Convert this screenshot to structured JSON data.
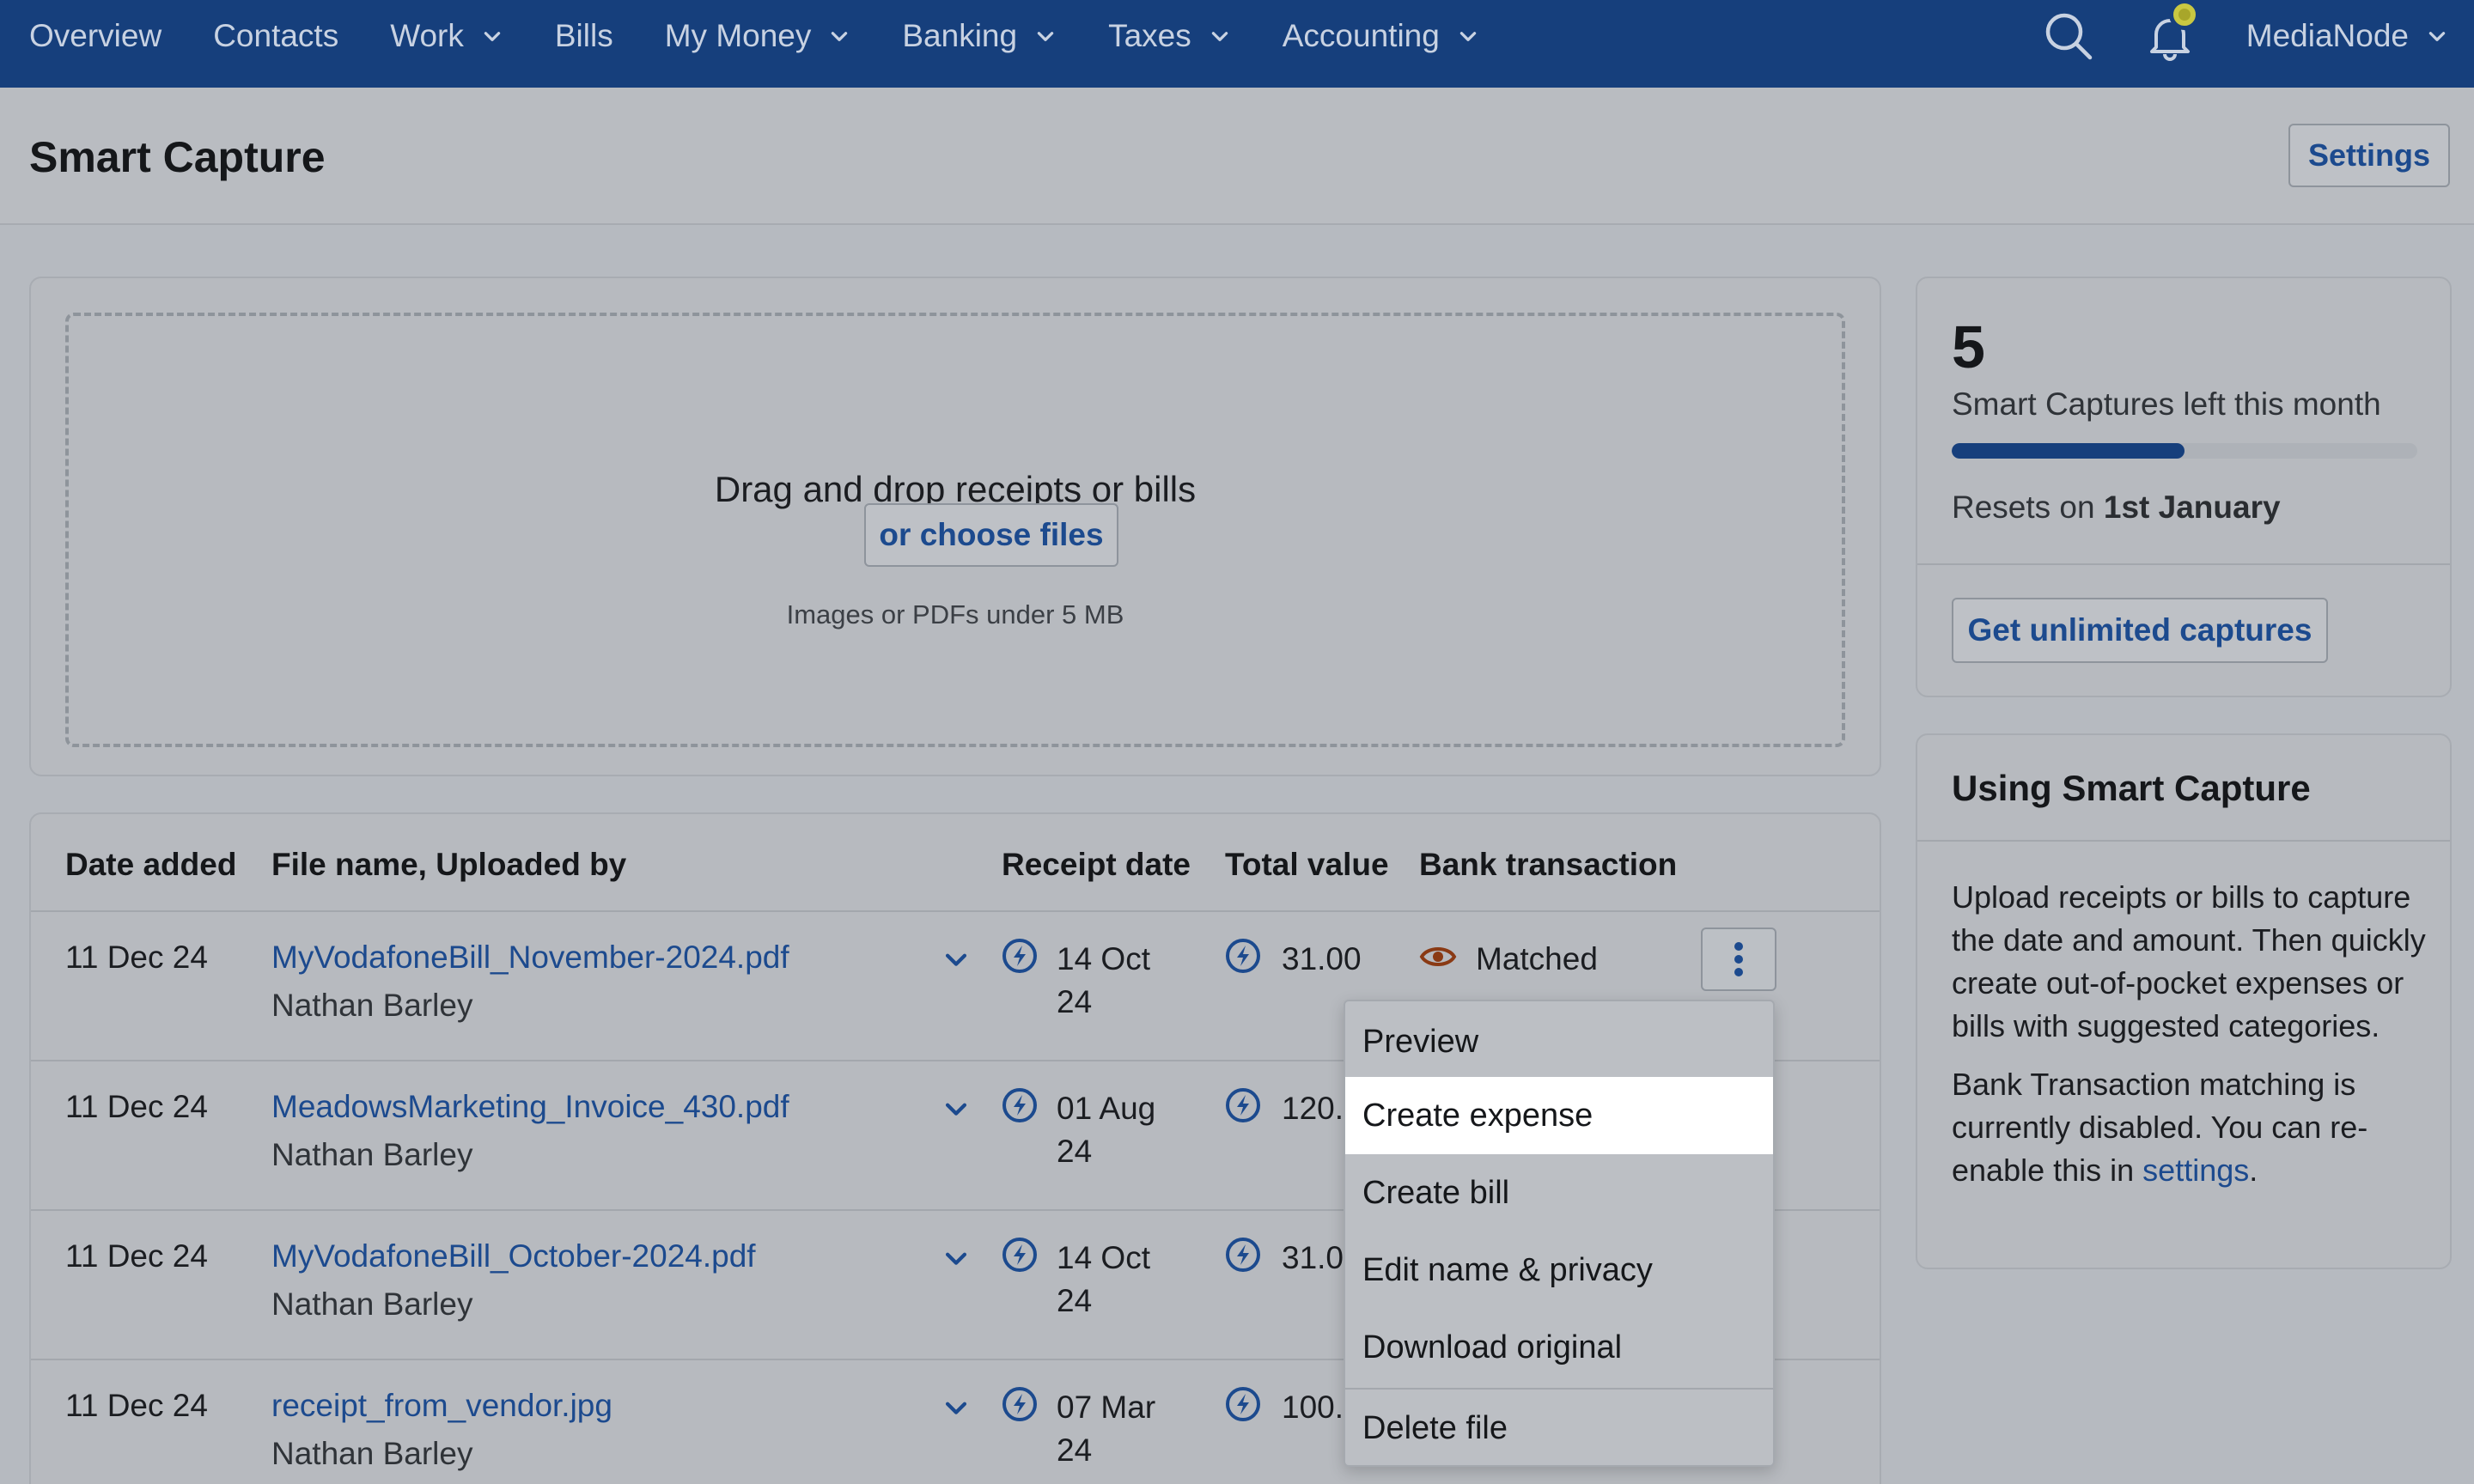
{
  "nav": {
    "items": [
      {
        "label": "Overview",
        "dropdown": false
      },
      {
        "label": "Contacts",
        "dropdown": false
      },
      {
        "label": "Work",
        "dropdown": true
      },
      {
        "label": "Bills",
        "dropdown": false
      },
      {
        "label": "My Money",
        "dropdown": true
      },
      {
        "label": "Banking",
        "dropdown": true
      },
      {
        "label": "Taxes",
        "dropdown": true
      },
      {
        "label": "Accounting",
        "dropdown": true
      }
    ],
    "user_label": "MediaNode",
    "search_icon": "search-icon",
    "bell_icon": "bell-icon",
    "bg_color": "#163f7c"
  },
  "page": {
    "title": "Smart Capture",
    "settings_label": "Settings"
  },
  "upload": {
    "title": "Drag and drop receipts or bills",
    "choose_label": "or choose files",
    "hint": "Images or PDFs under 5 MB"
  },
  "table": {
    "headers": {
      "date_added": "Date added",
      "file": "File name, Uploaded by",
      "receipt_date": "Receipt date",
      "total_value": "Total value",
      "bank_transaction": "Bank transaction"
    },
    "rows": [
      {
        "date_added": "11 Dec 24",
        "file_name": "MyVodafoneBill_November-2024.pdf",
        "uploaded_by": "Nathan Barley",
        "receipt_day": "14 Oct",
        "receipt_year": "24",
        "total": "31.00",
        "bank_status": "Matched"
      },
      {
        "date_added": "11 Dec 24",
        "file_name": "MeadowsMarketing_Invoice_430.pdf",
        "uploaded_by": "Nathan Barley",
        "receipt_day": "01 Aug",
        "receipt_year": "24",
        "total": "120.00",
        "bank_status": ""
      },
      {
        "date_added": "11 Dec 24",
        "file_name": "MyVodafoneBill_October-2024.pdf",
        "uploaded_by": "Nathan Barley",
        "receipt_day": "14 Oct",
        "receipt_year": "24",
        "total": "31.00",
        "bank_status": ""
      },
      {
        "date_added": "11 Dec 24",
        "file_name": "receipt_from_vendor.jpg",
        "uploaded_by": "Nathan Barley",
        "receipt_day": "07 Mar",
        "receipt_year": "24",
        "total": "100.00",
        "bank_status": ""
      }
    ]
  },
  "menu": {
    "items": [
      "Preview",
      "Create expense",
      "Create bill",
      "Edit name & privacy",
      "Download original",
      "Delete file"
    ],
    "active": "Create expense"
  },
  "captures": {
    "count": "5",
    "label": "Smart Captures left this month",
    "progress": 0.5,
    "resets_prefix": "Resets on",
    "resets_date": "1st January",
    "unlimited_label": "Get unlimited captures"
  },
  "info": {
    "title": "Using Smart Capture",
    "p1": "Upload receipts or bills to capture the date and amount. Then quickly create out-of-pocket expenses or bills with suggested categories.",
    "p2_prefix": "Bank Transaction matching is currently disabled. You can re-enable this in",
    "p2_link": "settings",
    "p2_suffix": "."
  }
}
